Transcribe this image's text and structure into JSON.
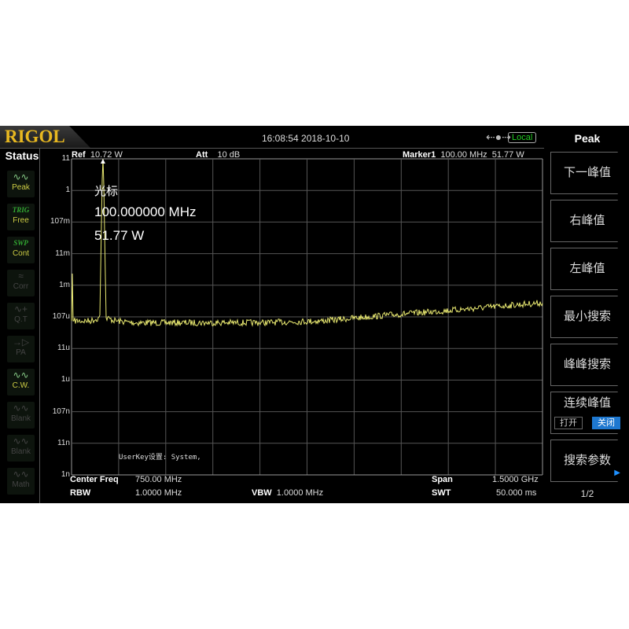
{
  "header": {
    "logo": "RIGOL",
    "datetime": "16:08:54 2018-10-10",
    "usb_icon": "usb-icon",
    "remote_status": "Local"
  },
  "status": {
    "title": "Status",
    "items": [
      {
        "icon": "peak-wave-icon",
        "label": "Peak",
        "active": true
      },
      {
        "icon": "TRIG",
        "label": "Free",
        "active": true
      },
      {
        "icon": "SWP",
        "label": "Cont",
        "active": true
      },
      {
        "icon": "corr-icon",
        "label": "Corr",
        "active": false
      },
      {
        "icon": "qt-icon",
        "label": "Q.T",
        "active": false
      },
      {
        "icon": "pa-icon",
        "label": "PA",
        "active": false
      },
      {
        "icon": "cw-wave-icon",
        "label": "C.W.",
        "active": true
      },
      {
        "icon": "wave-icon",
        "label": "Blank",
        "active": false
      },
      {
        "icon": "wave-icon",
        "label": "Blank",
        "active": false
      },
      {
        "icon": "wave-icon",
        "label": "Math",
        "active": false
      }
    ]
  },
  "top_info": {
    "ref_label": "Ref",
    "ref_value": "10.72 W",
    "att_label": "Att",
    "att_value": "10 dB",
    "marker_label": "Marker1",
    "marker_freq": "100.00 MHz",
    "marker_level": "51.77 W"
  },
  "marker_readout": {
    "title": "光标",
    "freq": "100.000000 MHz",
    "level": "51.77 W"
  },
  "userkey_text": "UserKey设置:  System,",
  "bottom_info": {
    "center_label": "Center Freq",
    "center_value": "750.00 MHz",
    "span_label": "Span",
    "span_value": "1.5000 GHz",
    "rbw_label": "RBW",
    "rbw_value": "1.0000 MHz",
    "vbw_label": "VBW",
    "vbw_value": "1.0000 MHz",
    "swt_label": "SWT",
    "swt_value": "50.000 ms"
  },
  "menu": {
    "title": "Peak",
    "keys": [
      "下一峰值",
      "右峰值",
      "左峰值",
      "最小搜索",
      "峰峰搜索"
    ],
    "continuous_label": "连续峰值",
    "on_label": "打开",
    "off_label": "关闭",
    "continuous_state": "off",
    "search_params": "搜索参数",
    "page": "1/2",
    "accent": "#1e78d0"
  },
  "chart_data": {
    "type": "line",
    "xlabel": "",
    "ylabel": "",
    "x_unit": "MHz",
    "xlim": [
      0,
      1500
    ],
    "y_scale": "log",
    "y_unit": "W",
    "y_tick_labels": [
      "11",
      "1",
      "107m",
      "11m",
      "1m",
      "107u",
      "11u",
      "1u",
      "107n",
      "11n",
      "1n"
    ],
    "ylim": [
      1.072e-09,
      10.72
    ],
    "grid": true,
    "trace_color": "#e8e870",
    "series": [
      {
        "x": [
          0,
          1,
          5,
          60,
          90,
          100,
          110,
          140,
          200,
          400,
          600,
          800,
          1000,
          1200,
          1400,
          1500
        ],
        "y": [
          8e-05,
          0.02,
          8e-05,
          8e-05,
          0.0001,
          51.77,
          0.0001,
          8e-05,
          7e-05,
          7e-05,
          7e-05,
          8e-05,
          0.00012,
          0.00017,
          0.00025,
          0.0003
        ]
      }
    ],
    "markers": [
      {
        "name": "Marker1",
        "x": 100,
        "y": 51.77
      }
    ]
  }
}
